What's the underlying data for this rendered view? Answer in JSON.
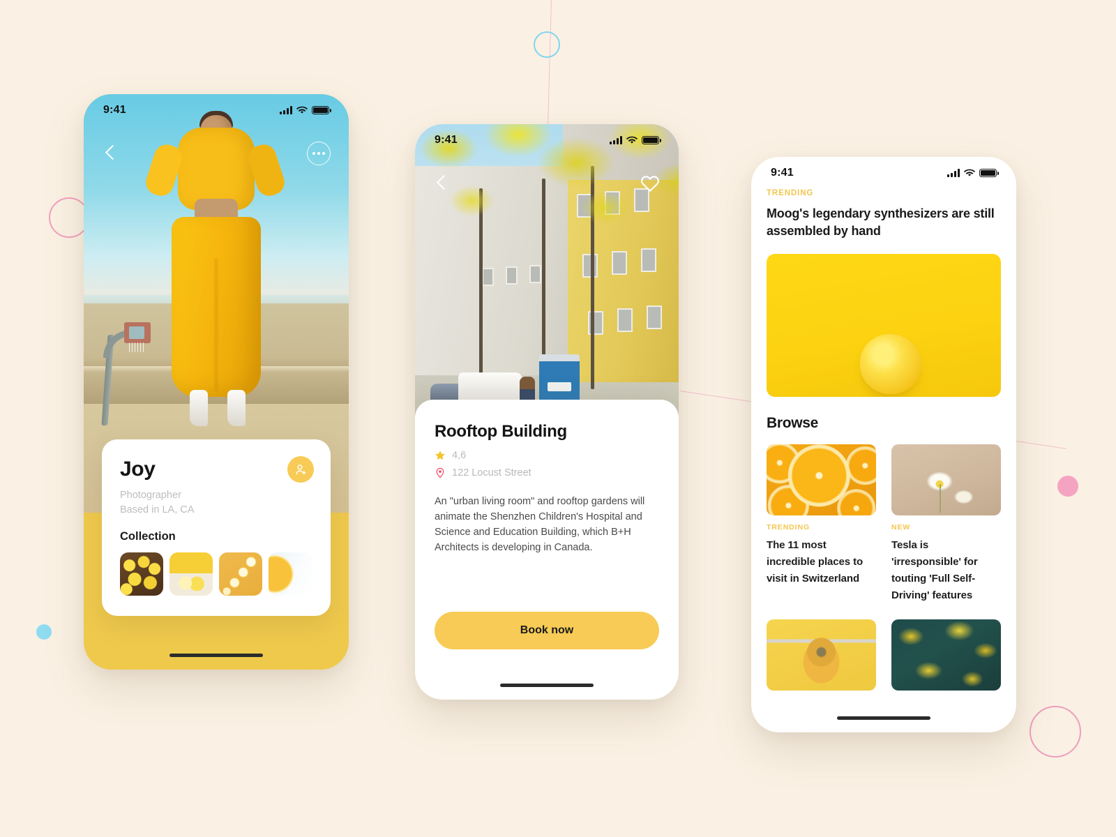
{
  "canvas": {
    "background_color": "#FAF1E4",
    "accent_yellow": "#F7CB55",
    "hero_yellow": "#EFC94C",
    "pink": "#F2A0BC",
    "cyan": "#7FD6EC"
  },
  "phone1": {
    "status": {
      "time": "9:41",
      "signal_icon": "signal-bars-icon",
      "wifi_icon": "wifi-icon",
      "battery_icon": "battery-icon"
    },
    "back_icon": "chevron-left-icon",
    "more_icon": "more-options-icon",
    "photo_alt": "woman-in-yellow-tracksuit-basketball-court",
    "card": {
      "name": "Joy",
      "role": "Photographer",
      "location": "Based in LA, CA",
      "follow_icon": "add-person-icon",
      "collection_label": "Collection",
      "thumbnails": [
        {
          "name": "lemons-in-crate"
        },
        {
          "name": "lemon-halves-on-yellow"
        },
        {
          "name": "lemon-slices-on-orange"
        },
        {
          "name": "orange-slice-on-white"
        }
      ]
    }
  },
  "phone2": {
    "status": {
      "time": "9:41",
      "signal_icon": "signal-bars-icon",
      "wifi_icon": "wifi-icon",
      "battery_icon": "battery-icon"
    },
    "back_icon": "chevron-left-icon",
    "favorite_icon": "heart-icon",
    "photo_alt": "yellow-blossom-street-with-buildings",
    "detail": {
      "title": "Rooftop Building",
      "rating": "4,6",
      "rating_icon": "star-icon",
      "address": "122 Locust Street",
      "address_icon": "location-pin-icon",
      "description": "An \"urban living room\" and rooftop gardens will animate the Shenzhen Children's Hospital and Science and Education Building, which B+H Architects is developing in Canada.",
      "cta_label": "Book now"
    }
  },
  "phone3": {
    "status": {
      "time": "9:41",
      "signal_icon": "signal-bars-icon",
      "wifi_icon": "wifi-icon",
      "battery_icon": "battery-icon"
    },
    "featured": {
      "kicker": "TRENDING",
      "headline": "Moog's legendary synthesizers are still assembled by hand",
      "image_alt": "lemon-on-yellow-background"
    },
    "browse_label": "Browse",
    "news": [
      {
        "kicker": "TRENDING",
        "title": "The 11 most incredible places to visit in Switzerland",
        "image_alt": "orange-slices"
      },
      {
        "kicker": "NEW",
        "title": "Tesla is 'irresponsible' for touting 'Full Self-Driving' features",
        "image_alt": "white-poppy-flower"
      },
      {
        "kicker": "",
        "title": "",
        "image_alt": "yellow-arched-door"
      },
      {
        "kicker": "",
        "title": "",
        "image_alt": "yellow-autumn-foliage"
      }
    ]
  }
}
